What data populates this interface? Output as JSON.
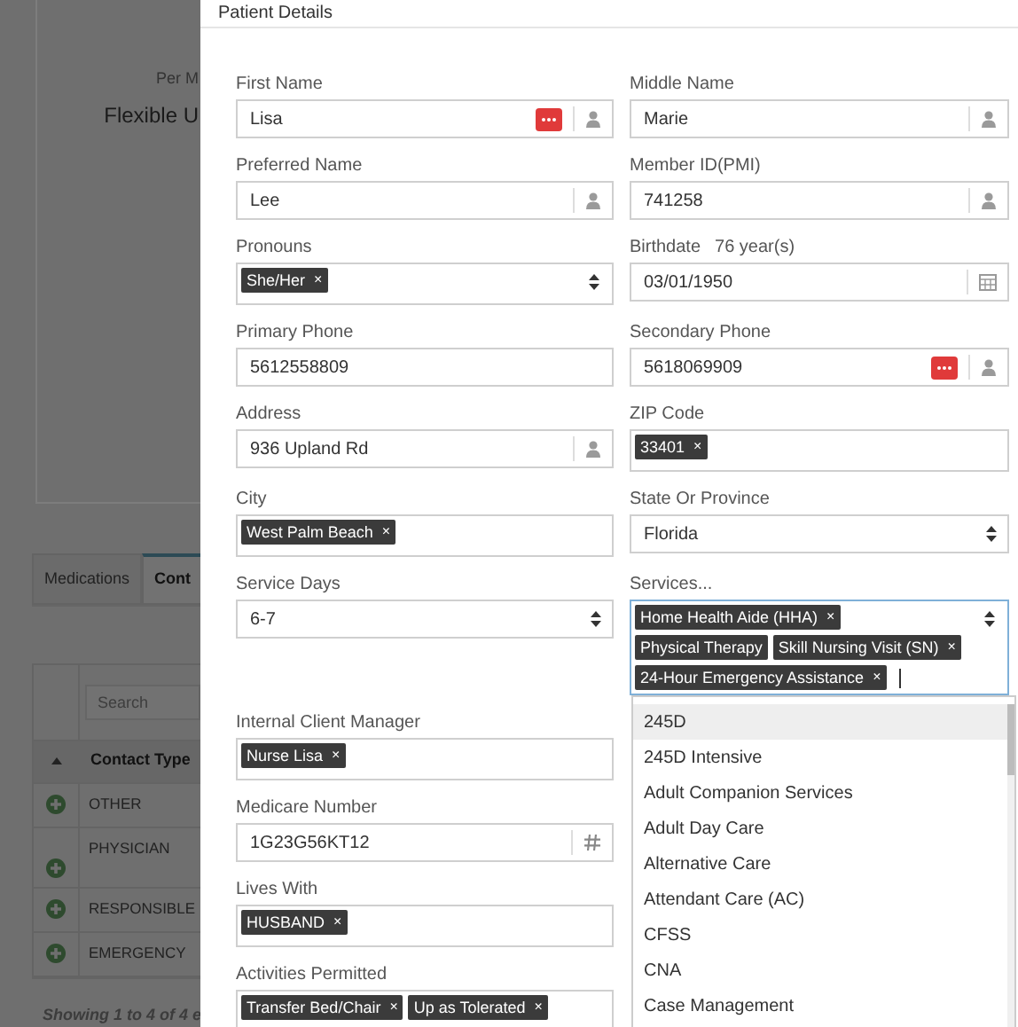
{
  "background": {
    "card": {
      "caption": "Per M",
      "title": "Flexible U"
    },
    "tabs": [
      {
        "label": "Medications",
        "selected": false
      },
      {
        "label": "Cont",
        "selected": true
      }
    ],
    "table": {
      "search": {
        "placeholder": "Search"
      },
      "columns": [
        "Contact Type"
      ],
      "rows": [
        {
          "contact_type": "OTHER",
          "tall": false
        },
        {
          "contact_type": "PHYSICIAN",
          "tall": true
        },
        {
          "contact_type": "RESPONSIBLE",
          "tall": false
        },
        {
          "contact_type": "EMERGENCY",
          "tall": false
        }
      ],
      "footer": "Showing 1 to 4 of 4 e"
    }
  },
  "modal": {
    "title": "Patient Details",
    "rows": [
      [
        {
          "label": "First Name",
          "kind": "profile",
          "value": "Lisa",
          "flagged": true
        },
        {
          "label": "Middle Name",
          "kind": "profile",
          "value": "Marie",
          "flagged": false
        }
      ],
      [
        {
          "label": "Preferred Name",
          "kind": "profile",
          "value": "Lee",
          "flagged": false
        },
        {
          "label": "Member ID(PMI)",
          "kind": "profile",
          "value": "741258",
          "flagged": false
        }
      ],
      [
        {
          "label": "Pronouns",
          "kind": "tag-select",
          "focused": false,
          "tags": [
            {
              "text": "She/Her",
              "remove": "×"
            }
          ]
        },
        {
          "label": "Birthdate",
          "note": "76 year(s)",
          "kind": "date",
          "value": "03/01/1950"
        }
      ],
      [
        {
          "label": "Primary Phone",
          "kind": "text",
          "value": "5612558809",
          "flagged": false
        },
        {
          "label": "Secondary Phone",
          "kind": "profile",
          "value": "5618069909",
          "flagged": true
        }
      ],
      [
        {
          "label": "Address",
          "kind": "profile",
          "value": "936 Upland Rd",
          "flagged": false
        },
        {
          "label": "ZIP Code",
          "kind": "tags",
          "tags": [
            {
              "text": "33401",
              "remove": "×"
            }
          ]
        }
      ],
      [
        {
          "label": "City",
          "kind": "tags",
          "tags": [
            {
              "text": "West Palm Beach",
              "remove": "×"
            }
          ]
        },
        {
          "label": "State Or Province",
          "kind": "select",
          "value": "Florida"
        }
      ],
      [
        {
          "label": "Service Days",
          "kind": "select",
          "value": "6-7"
        },
        {
          "label": "Services...",
          "kind": "tag-select",
          "focused": true,
          "tags": [
            {
              "text": "Home Health Aide (HHA)",
              "remove": "×"
            },
            {
              "text": "Physical Therapy"
            },
            {
              "text": "Skill Nursing Visit (SN)",
              "remove": "×"
            },
            {
              "text": "24-Hour Emergency Assistance",
              "remove": "×"
            }
          ]
        }
      ],
      [
        {
          "label": "Internal Client Manager",
          "kind": "tags",
          "tags": [
            {
              "text": "Nurse Lisa",
              "remove": "×"
            }
          ]
        }
      ],
      [
        {
          "label": "Medicare Number",
          "kind": "code",
          "value": "1G23G56KT12",
          "flagged": false
        }
      ],
      [
        {
          "label": "Lives With",
          "kind": "tags",
          "tags": [
            {
              "text": "HUSBAND",
              "remove": "×"
            }
          ]
        }
      ],
      [
        {
          "label": "Activities Permitted",
          "kind": "tags",
          "tags": [
            {
              "text": "Transfer Bed/Chair",
              "remove": "×"
            },
            {
              "text": "Up as Tolerated",
              "remove": "×"
            }
          ]
        }
      ]
    ],
    "dropdown": {
      "options": [
        {
          "label": "245D",
          "selected": true
        },
        {
          "label": "245D Intensive",
          "selected": false
        },
        {
          "label": "Adult Companion Services",
          "selected": false
        },
        {
          "label": "Adult Day Care",
          "selected": false
        },
        {
          "label": "Alternative Care",
          "selected": false
        },
        {
          "label": "Attendant Care (AC)",
          "selected": false
        },
        {
          "label": "CFSS",
          "selected": false
        },
        {
          "label": "CNA",
          "selected": false
        },
        {
          "label": "Case Management",
          "selected": false
        }
      ]
    }
  }
}
